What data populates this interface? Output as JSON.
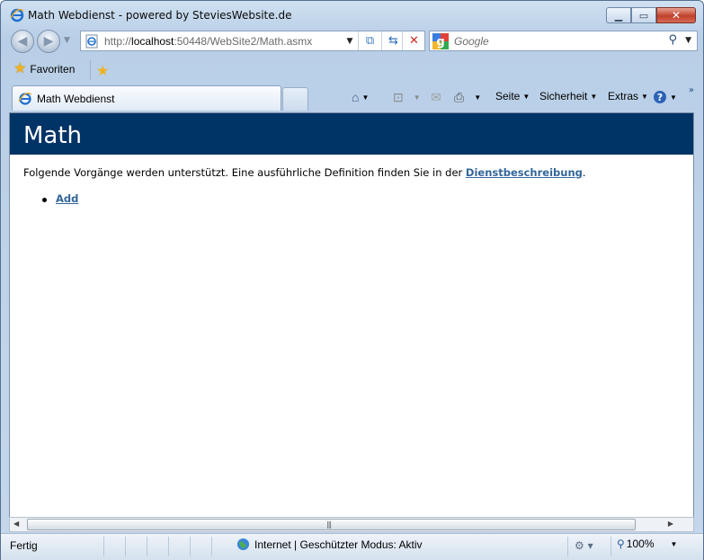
{
  "window": {
    "title": "Math Webdienst - powered by SteviesWebsite.de"
  },
  "address_bar": {
    "url_prefix": "http://",
    "url_host": "localhost",
    "url_rest": ":50448/WebSite2/Math.asmx"
  },
  "search": {
    "placeholder": "Google"
  },
  "favorites_bar": {
    "favorites_label": "Favoriten"
  },
  "tabs": [
    {
      "label": "Math Webdienst",
      "active": true
    }
  ],
  "command_bar": {
    "page_label": "Seite",
    "safety_label": "Sicherheit",
    "tools_label": "Extras"
  },
  "page": {
    "heading": "Math",
    "intro_text": "Folgende Vorgänge werden unterstützt. Eine ausführliche Definition finden Sie in der ",
    "intro_link": "Dienstbeschreibung",
    "intro_end": ".",
    "operations": [
      "Add"
    ]
  },
  "status_bar": {
    "status_text": "Fertig",
    "zone_text": "Internet | Geschützter Modus: Aktiv",
    "zoom_level": "100%"
  },
  "colors": {
    "heading_bg": "#003366",
    "link": "#336699"
  }
}
